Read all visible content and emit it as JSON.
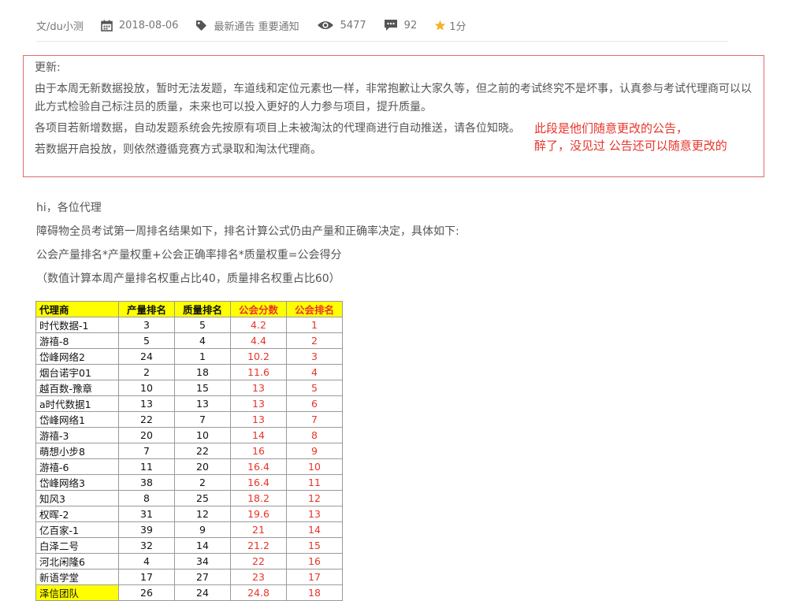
{
  "meta": {
    "author": "文/du小测",
    "date": "2018-08-06",
    "tags": "最新通告 重要通知",
    "views": "5477",
    "comments": "92",
    "rating": "1分"
  },
  "notice": {
    "heading": "更新:",
    "para1": "由于本周无新数据投放，暂时无法发题，车道线和定位元素也一样，非常抱歉让大家久等，但之前的考试终究不是坏事，认真参与考试代理商可以以此方式检验自己标注员的质量，未来也可以投入更好的人力参与项目，提升质量。",
    "para2": "各项目若新增数据，自动发题系统会先按原有项目上未被淘汰的代理商进行自动推送，请各位知晓。",
    "para3": "若数据开启投放，则依然遵循竞赛方式录取和淘汰代理商。"
  },
  "annotation": {
    "line1": "此段是他们随意更改的公告，",
    "line2": "醉了，没见过  公告还可以随意更改的"
  },
  "body": {
    "greeting": "hi，各位代理",
    "line1": "障碍物全员考试第一周排名结果如下，排名计算公式仍由产量和正确率决定，具体如下:",
    "formula": "公会产量排名*产量权重+公会正确率排名*质量权重=公会得分",
    "weights": "（数值计算本周产量排名权重占比40，质量排名权重占比60）"
  },
  "table": {
    "headers": [
      "代理商",
      "产量排名",
      "质量排名",
      "公会分数",
      "公会排名"
    ],
    "rows": [
      [
        "时代数据-1",
        "3",
        "5",
        "4.2",
        "1"
      ],
      [
        "游禧-8",
        "5",
        "4",
        "4.4",
        "2"
      ],
      [
        "岱峰网络2",
        "24",
        "1",
        "10.2",
        "3"
      ],
      [
        "烟台诺宇01",
        "2",
        "18",
        "11.6",
        "4"
      ],
      [
        "越百数-豫章",
        "10",
        "15",
        "13",
        "5"
      ],
      [
        "a时代数据1",
        "13",
        "13",
        "13",
        "6"
      ],
      [
        "岱峰网络1",
        "22",
        "7",
        "13",
        "7"
      ],
      [
        "游禧-3",
        "20",
        "10",
        "14",
        "8"
      ],
      [
        "萌想小步8",
        "7",
        "22",
        "16",
        "9"
      ],
      [
        "游禧-6",
        "11",
        "20",
        "16.4",
        "10"
      ],
      [
        "岱峰网络3",
        "38",
        "2",
        "16.4",
        "11"
      ],
      [
        "知风3",
        "8",
        "25",
        "18.2",
        "12"
      ],
      [
        "权晖-2",
        "31",
        "12",
        "19.6",
        "13"
      ],
      [
        "亿百家-1",
        "39",
        "9",
        "21",
        "14"
      ],
      [
        "白泽二号",
        "32",
        "14",
        "21.2",
        "15"
      ],
      [
        "河北闲隆6",
        "4",
        "34",
        "22",
        "16"
      ],
      [
        "新语学堂",
        "17",
        "27",
        "23",
        "17"
      ],
      [
        "泽信团队",
        "26",
        "24",
        "24.8",
        "18"
      ]
    ]
  }
}
